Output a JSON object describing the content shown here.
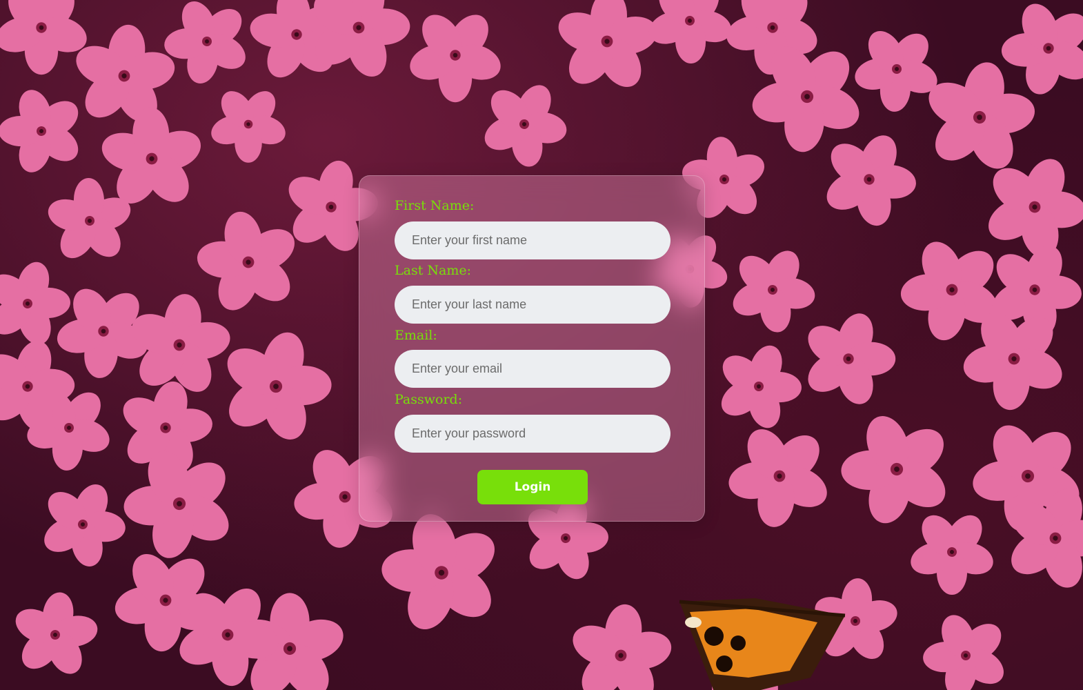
{
  "form": {
    "first_name": {
      "label": "First Name:",
      "placeholder": "Enter your first name",
      "value": ""
    },
    "last_name": {
      "label": "Last Name:",
      "placeholder": "Enter your last name",
      "value": ""
    },
    "email": {
      "label": "Email:",
      "placeholder": "Enter your email",
      "value": ""
    },
    "password": {
      "label": "Password:",
      "placeholder": "Enter your password",
      "value": ""
    },
    "login_label": "Login"
  },
  "colors": {
    "accent": "#78df0a",
    "input_bg": "#eceef1",
    "flower_pink": "#e56fa3",
    "background": "#3b0c22"
  },
  "background": {
    "icon": "pink-flowers-photo"
  }
}
